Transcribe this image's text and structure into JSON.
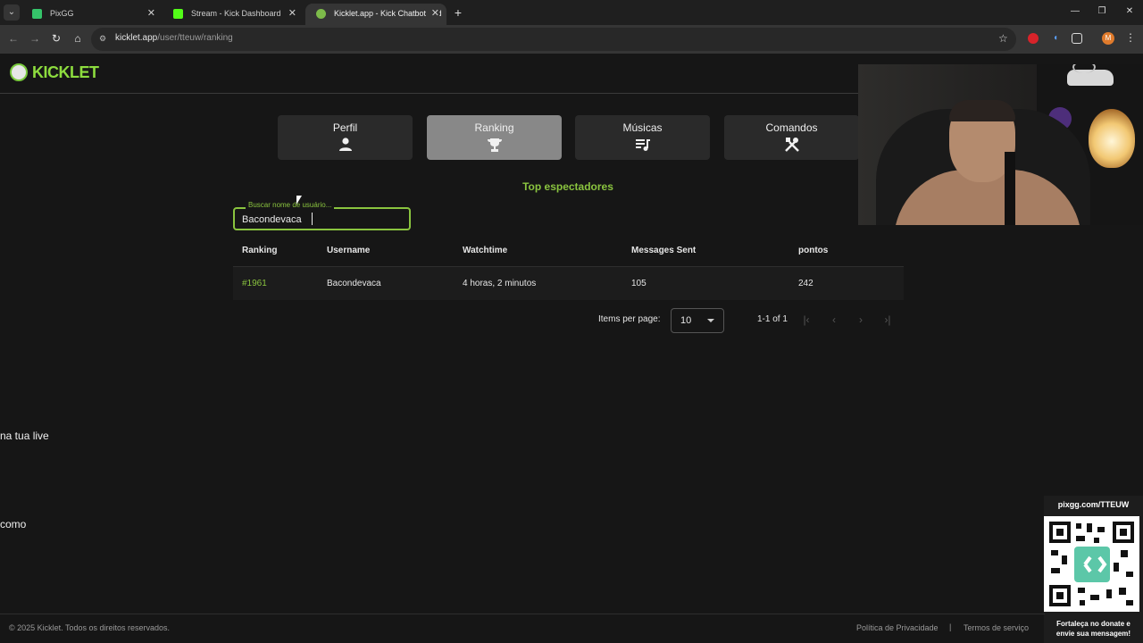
{
  "browser": {
    "tabs": [
      {
        "title": "PixGG",
        "active": false,
        "favicon_color": "#35c46a"
      },
      {
        "title": "Stream - Kick Dashboard",
        "active": false,
        "favicon_color": "#53fc18"
      },
      {
        "title": "Kicklet.app - Kick Chatbot and",
        "active": true,
        "favicon_color": "#7dbb4a"
      }
    ],
    "url_host": "kicklet.app",
    "url_path": "/user/tteuw/ranking",
    "profile_initial": "M"
  },
  "site": {
    "logo_text": "KICKLET",
    "nav": [
      {
        "label": "Perfil",
        "icon": "user-icon",
        "active": false
      },
      {
        "label": "Ranking",
        "icon": "trophy-icon",
        "active": true
      },
      {
        "label": "Músicas",
        "icon": "playlist-icon",
        "active": false
      },
      {
        "label": "Comandos",
        "icon": "tools-icon",
        "active": false
      }
    ],
    "section_title": "Top espectadores",
    "search": {
      "label": "Buscar nome de usuário...",
      "value": "Bacondevaca"
    },
    "table": {
      "headers": [
        "Ranking",
        "Username",
        "Watchtime",
        "Messages Sent",
        "pontos"
      ],
      "rows": [
        [
          "#1961",
          "Bacondevaca",
          "4 horas, 2 minutos",
          "105",
          "242"
        ]
      ]
    },
    "pagination": {
      "items_per_page_label": "Items per page:",
      "items_per_page_value": "10",
      "range_text": "1-1 of 1"
    },
    "footer": {
      "copyright": "© 2025 Kicklet. Todos os direitos reservados.",
      "privacy": "Política de Privacidade",
      "separator": "|",
      "terms": "Termos de serviço"
    }
  },
  "overlay": {
    "side_text_1": "na tua live",
    "side_text_2": "como",
    "qr_title": "pixgg.com/TTEUW",
    "qr_caption_1": "Fortaleça no donate e",
    "qr_caption_2": "envie sua mensagem!"
  },
  "colors": {
    "accent": "#8ac43f",
    "background": "#161616"
  }
}
